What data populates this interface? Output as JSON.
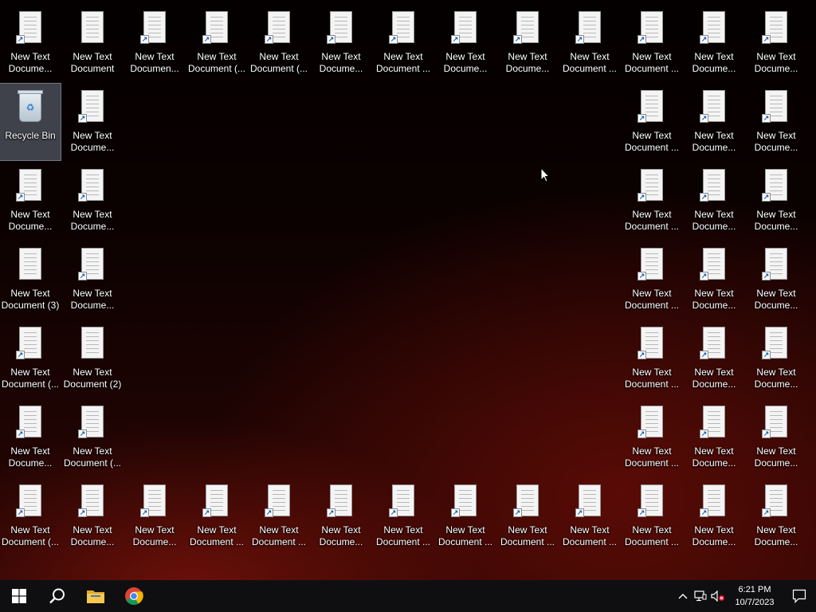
{
  "desktop": {
    "icons": [
      {
        "label": "New Text\nDocume...",
        "type": "doc",
        "shortcut": true
      },
      {
        "label": "New Text\nDocument",
        "type": "doc",
        "shortcut": false
      },
      {
        "label": "New Text\nDocumen...",
        "type": "doc",
        "shortcut": true
      },
      {
        "label": "New Text\nDocument (...",
        "type": "doc",
        "shortcut": true
      },
      {
        "label": "New Text\nDocument (...",
        "type": "doc",
        "shortcut": true
      },
      {
        "label": "New Text\nDocume...",
        "type": "doc",
        "shortcut": true
      },
      {
        "label": "New Text\nDocument ...",
        "type": "doc",
        "shortcut": true
      },
      {
        "label": "New Text\nDocume...",
        "type": "doc",
        "shortcut": true
      },
      {
        "label": "New Text\nDocume...",
        "type": "doc",
        "shortcut": true
      },
      {
        "label": "New Text\nDocument ...",
        "type": "doc",
        "shortcut": true
      },
      {
        "label": "New Text\nDocument ...",
        "type": "doc",
        "shortcut": true
      },
      {
        "label": "New Text\nDocume...",
        "type": "doc",
        "shortcut": true
      },
      {
        "label": "New Text\nDocume...",
        "type": "doc",
        "shortcut": true
      },
      {
        "label": "Recycle Bin",
        "type": "bin",
        "shortcut": false,
        "selected": true
      },
      {
        "label": "New Text\nDocume...",
        "type": "doc",
        "shortcut": true
      },
      {
        "label": "New Text\nDocument ...",
        "type": "doc",
        "shortcut": true
      },
      {
        "label": "New Text\nDocume...",
        "type": "doc",
        "shortcut": true
      },
      {
        "label": "New Text\nDocume...",
        "type": "doc",
        "shortcut": true
      },
      {
        "label": "New Text\nDocume...",
        "type": "doc",
        "shortcut": true
      },
      {
        "label": "New Text\nDocume...",
        "type": "doc",
        "shortcut": true
      },
      {
        "label": "New Text\nDocument ...",
        "type": "doc",
        "shortcut": true
      },
      {
        "label": "New Text\nDocume...",
        "type": "doc",
        "shortcut": true
      },
      {
        "label": "New Text\nDocume...",
        "type": "doc",
        "shortcut": true
      },
      {
        "label": "New Text\nDocument (3)",
        "type": "doc",
        "shortcut": false
      },
      {
        "label": "New Text\nDocume...",
        "type": "doc",
        "shortcut": true
      },
      {
        "label": "New Text\nDocument ...",
        "type": "doc",
        "shortcut": true
      },
      {
        "label": "New Text\nDocume...",
        "type": "doc",
        "shortcut": true
      },
      {
        "label": "New Text\nDocume...",
        "type": "doc",
        "shortcut": true
      },
      {
        "label": "New Text\nDocument (...",
        "type": "doc",
        "shortcut": true
      },
      {
        "label": "New Text\nDocument (2)",
        "type": "doc",
        "shortcut": false
      },
      {
        "label": "New Text\nDocument ...",
        "type": "doc",
        "shortcut": true
      },
      {
        "label": "New Text\nDocume...",
        "type": "doc",
        "shortcut": true
      },
      {
        "label": "New Text\nDocume...",
        "type": "doc",
        "shortcut": true
      },
      {
        "label": "New Text\nDocume...",
        "type": "doc",
        "shortcut": true
      },
      {
        "label": "New Text\nDocument (...",
        "type": "doc",
        "shortcut": true
      },
      {
        "label": "New Text\nDocument ...",
        "type": "doc",
        "shortcut": true
      },
      {
        "label": "New Text\nDocume...",
        "type": "doc",
        "shortcut": true
      },
      {
        "label": "New Text\nDocume...",
        "type": "doc",
        "shortcut": true
      },
      {
        "label": "New Text\nDocument (...",
        "type": "doc",
        "shortcut": true
      },
      {
        "label": "New Text\nDocume...",
        "type": "doc",
        "shortcut": true
      },
      {
        "label": "New Text\nDocume...",
        "type": "doc",
        "shortcut": true
      },
      {
        "label": "New Text\nDocument ...",
        "type": "doc",
        "shortcut": true
      },
      {
        "label": "New Text\nDocument ...",
        "type": "doc",
        "shortcut": true
      },
      {
        "label": "New Text\nDocume...",
        "type": "doc",
        "shortcut": true
      },
      {
        "label": "New Text\nDocument ...",
        "type": "doc",
        "shortcut": true
      },
      {
        "label": "New Text\nDocument ...",
        "type": "doc",
        "shortcut": true
      },
      {
        "label": "New Text\nDocument ...",
        "type": "doc",
        "shortcut": true
      },
      {
        "label": "New Text\nDocument ...",
        "type": "doc",
        "shortcut": true
      },
      {
        "label": "New Text\nDocument ...",
        "type": "doc",
        "shortcut": true
      },
      {
        "label": "New Text\nDocume...",
        "type": "doc",
        "shortcut": true
      },
      {
        "label": "New Text\nDocume...",
        "type": "doc",
        "shortcut": true
      }
    ]
  },
  "taskbar": {
    "start": "windows-start-icon",
    "search": "search-icon",
    "pinned": [
      "file-explorer-icon",
      "chrome-icon"
    ],
    "tray_icons": [
      "chevron-up-icon",
      "network-icon",
      "volume-muted-icon"
    ],
    "time": "6:21 PM",
    "date": "10/7/2023",
    "notifications": "notification-icon"
  },
  "colors": {
    "taskbar": "#0f0f12",
    "accent": "#1a5fb4"
  }
}
